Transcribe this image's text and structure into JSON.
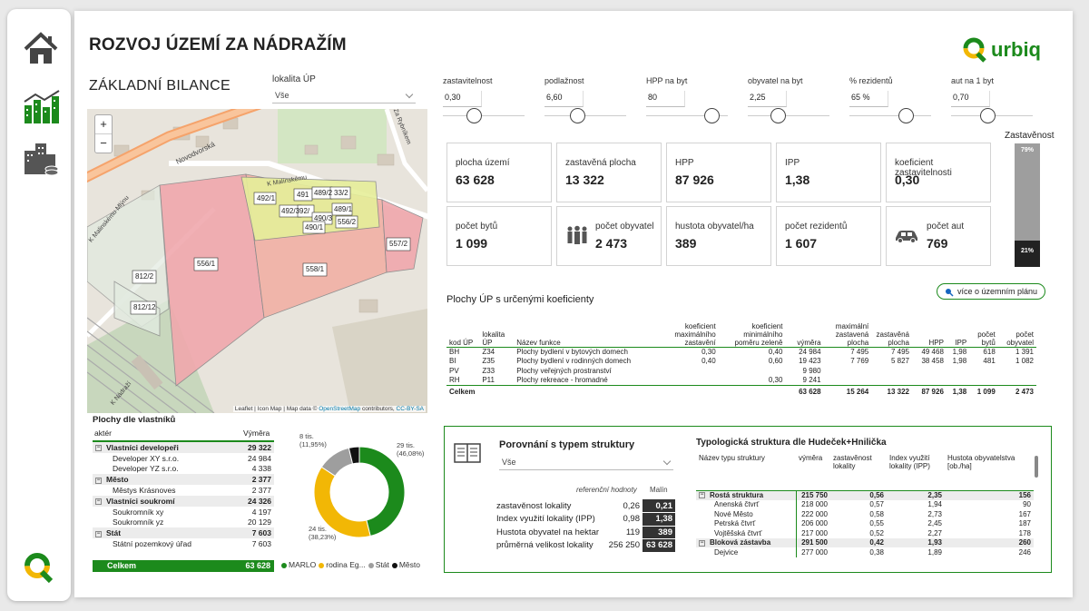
{
  "header": {
    "title": "ROZVOJ ÚZEMÍ ZA NÁDRAŽÍM",
    "subtitle": "ZÁKLADNÍ BILANCE",
    "logo_text": "urbiq"
  },
  "filter_locality": {
    "label": "lokalita ÚP",
    "value": "Vše"
  },
  "params": [
    {
      "label": "zastavitelnost",
      "value": "0,30"
    },
    {
      "label": "podlažnost",
      "value": "6,60"
    },
    {
      "label": "HPP na byt",
      "value": "80"
    },
    {
      "label": "obyvatel na byt",
      "value": "2,25"
    },
    {
      "label": "% rezidentů",
      "value": "65 %"
    },
    {
      "label": "aut na 1 byt",
      "value": "0,70"
    }
  ],
  "kpi_cards": [
    {
      "label": "plocha území",
      "value": "63 628"
    },
    {
      "label": "zastavěná plocha",
      "value": "13 322"
    },
    {
      "label": "HPP",
      "value": "87 926"
    },
    {
      "label": "IPP",
      "value": "1,38"
    },
    {
      "label": "koeficient zastavitelnosti",
      "value": "0,30"
    },
    {
      "label": "počet bytů",
      "value": "1 099"
    },
    {
      "label": "počet obyvatel",
      "value": "2 473",
      "icon": "people-icon"
    },
    {
      "label": "hustota obyvatel/ha",
      "value": "389"
    },
    {
      "label": "počet rezidentů",
      "value": "1 607"
    },
    {
      "label": "počet aut",
      "value": "769",
      "icon": "car-icon"
    }
  ],
  "builtup_gauge": {
    "label": "Zastavěnost",
    "top_label": "79%",
    "bottom_label": "21%",
    "built_fraction": 0.21
  },
  "plan_button": {
    "label": "více o územním plánu"
  },
  "plan_table": {
    "title": "Plochy ÚP s určenými koeficienty",
    "headers": [
      "kod ÚP",
      "lokalita ÚP",
      "Název funkce",
      "koeficient maximálního zastavění",
      "koeficient minimálního poměru zeleně",
      "výměra",
      "maximální zastavená plocha",
      "zastavěná plocha",
      "HPP",
      "IPP",
      "počet bytů",
      "počet obyvatel"
    ],
    "rows": [
      [
        "BH",
        "Z34",
        "Plochy bydlení v bytových domech",
        "0,30",
        "0,40",
        "24 984",
        "7 495",
        "7 495",
        "49 468",
        "1,98",
        "618",
        "1 391"
      ],
      [
        "BI",
        "Z35",
        "Plochy bydlení v rodinných domech",
        "0,40",
        "0,60",
        "19 423",
        "7 769",
        "5 827",
        "38 458",
        "1,98",
        "481",
        "1 082"
      ],
      [
        "PV",
        "Z33",
        "Plochy veřejných prostranství",
        "",
        "",
        "9 980",
        "",
        "",
        "",
        "",
        "",
        ""
      ],
      [
        "RH",
        "P11",
        "Plochy rekreace - hromadné",
        "",
        "0,30",
        "9 241",
        "",
        "",
        "",
        "",
        "",
        ""
      ]
    ],
    "total": [
      "Celkem",
      "",
      "",
      "",
      "",
      "63 628",
      "15 264",
      "13 322",
      "87 926",
      "1,38",
      "1 099",
      "2 473"
    ]
  },
  "map": {
    "zoom_in": "+",
    "zoom_out": "−",
    "attribution_prefix": "Leaflet | Icon Map | Map data ©",
    "attribution_osm": "OpenStreetMap",
    "attribution_mid": "contributors,",
    "attribution_license": "CC-BY-SA",
    "street_labels": [
      "Novodvorská",
      "K Malinskému Mlýnu",
      "K Malínskému",
      "Za Rybníkem",
      "K Nádraží"
    ],
    "parcels": [
      "556/1",
      "558/1",
      "557/2",
      "812/2",
      "812/12",
      "492/1",
      "491",
      "489/2",
      "33/2",
      "492/3",
      "92/",
      "489/1",
      "490/3",
      "556/2",
      "490/1"
    ]
  },
  "ownership": {
    "title": "Plochy dle vlastníků",
    "col_actor": "aktér",
    "col_area": "Výměra",
    "rows": [
      {
        "label": "Vlastníci developeři",
        "value": "29 322",
        "level": 0
      },
      {
        "label": "Developer XY s.r.o.",
        "value": "24 984",
        "level": 1
      },
      {
        "label": "Developer YZ s.r.o.",
        "value": "4 338",
        "level": 1
      },
      {
        "label": "Město",
        "value": "2 377",
        "level": 0
      },
      {
        "label": "Městys Krásnoves",
        "value": "2 377",
        "level": 1
      },
      {
        "label": "Vlastníci soukromí",
        "value": "24 326",
        "level": 0
      },
      {
        "label": "Soukromník xy",
        "value": "4 197",
        "level": 1
      },
      {
        "label": "Soukromník yz",
        "value": "20 129",
        "level": 1
      },
      {
        "label": "Stát",
        "value": "7 603",
        "level": 0
      },
      {
        "label": "Státní pozemkový úřad",
        "value": "7 603",
        "level": 1
      }
    ],
    "total_label": "Celkem",
    "total_value": "63 628"
  },
  "donut_labels": {
    "l1": "29 tis.",
    "l1b": "(46,08%)",
    "l2": "24 tis.",
    "l2b": "(38,23%)",
    "l3": "8 tis.",
    "l3b": "(11,95%)"
  },
  "chart_data": {
    "type": "pie",
    "series": [
      {
        "name": "MARLO",
        "value": 29322,
        "color": "#1c8a1c"
      },
      {
        "name": "rodina Eg...",
        "value": 24326,
        "color": "#f2b705"
      },
      {
        "name": "Stát",
        "value": 7603,
        "color": "#9e9e9e"
      },
      {
        "name": "Město",
        "value": 2377,
        "color": "#111111"
      }
    ]
  },
  "comparison": {
    "title": "Porovnání s typem struktury",
    "select_value": "Vše",
    "col_ref": "referenční hodnoty",
    "col_malin": "Malín",
    "rows": [
      {
        "label": "zastavěnost lokality",
        "ref": "0,26",
        "val": "0,21"
      },
      {
        "label": "Index využití lokality (IPP)",
        "ref": "0,98",
        "val": "1,38"
      },
      {
        "label": "Hustota obyvatel na hektar",
        "ref": "119",
        "val": "389"
      },
      {
        "label": "průměrná velikost lokality",
        "ref": "256 250",
        "val": "63 628"
      }
    ]
  },
  "typology": {
    "title": "Typologická struktura dle Hudeček+Hnilička",
    "headers": [
      "Název typu struktury",
      "výměra",
      "zastavěnost lokality",
      "Index využití lokality (IPP)",
      "Hustota obyvatelstva [ob./ha]"
    ],
    "rows": [
      {
        "name": "Rostá struktura",
        "v": "215 750",
        "z": "0,56",
        "i": "2,35",
        "h": "156",
        "group": true
      },
      {
        "name": "Anenská čtvrť",
        "v": "218 000",
        "z": "0,57",
        "i": "1,94",
        "h": "90"
      },
      {
        "name": "Nové Město",
        "v": "222 000",
        "z": "0,58",
        "i": "2,73",
        "h": "167"
      },
      {
        "name": "Petrská čtvrť",
        "v": "206 000",
        "z": "0,55",
        "i": "2,45",
        "h": "187"
      },
      {
        "name": "Vojtěšská čtvrť",
        "v": "217 000",
        "z": "0,52",
        "i": "2,27",
        "h": "178"
      },
      {
        "name": "Bloková zástavba",
        "v": "291 500",
        "z": "0,42",
        "i": "1,93",
        "h": "260",
        "group": true
      },
      {
        "name": "Dejvice",
        "v": "277 000",
        "z": "0,38",
        "i": "1,89",
        "h": "246"
      }
    ]
  }
}
